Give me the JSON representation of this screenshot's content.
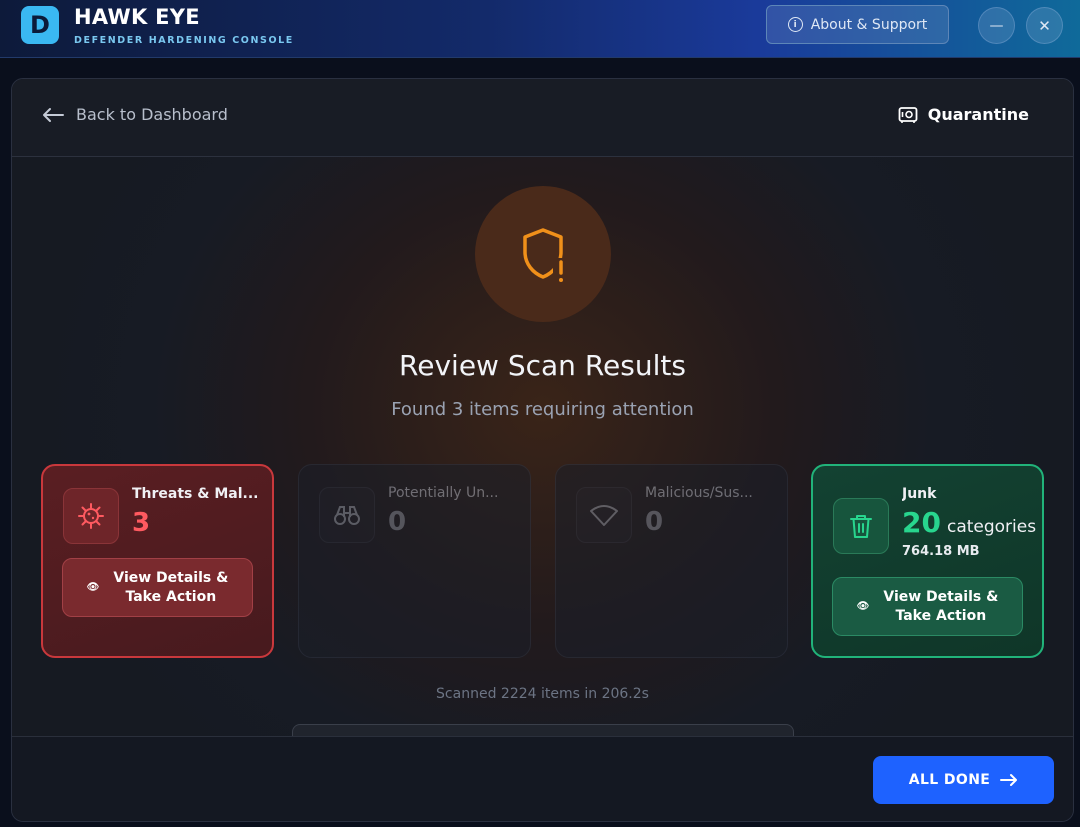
{
  "app": {
    "logo_letter": "D",
    "title": "HAWK EYE",
    "subtitle": "DEFENDER HARDENING CONSOLE",
    "about_label": "About & Support",
    "minimize_glyph": "—",
    "close_glyph": "✕"
  },
  "header": {
    "back_label": "Back to Dashboard",
    "quarantine_label": "Quarantine"
  },
  "main": {
    "title": "Review Scan Results",
    "subtitle": "Found 3 items requiring attention",
    "scan_summary": "Scanned 2224 items in 206.2s"
  },
  "cards": {
    "threats": {
      "name": "Threats & Mal...",
      "count": "3",
      "action_line1": "View Details &",
      "action_line2": "Take Action",
      "icon": "virus-icon"
    },
    "pup": {
      "name": "Potentially Un...",
      "count": "0",
      "icon": "binoculars-icon"
    },
    "malicious": {
      "name": "Malicious/Sus...",
      "count": "0",
      "icon": "wifi-icon"
    },
    "junk": {
      "name": "Junk",
      "count": "20",
      "unit": "categories",
      "size": "764.18 MB",
      "action_line1": "View Details &",
      "action_line2": "Take Action",
      "icon": "trash-icon"
    }
  },
  "footer": {
    "done_label": "ALL DONE"
  },
  "colors": {
    "accent_blue": "#1e62ff",
    "threat_red": "#ff5a60",
    "junk_green": "#28d58e",
    "shield_orange": "#f0901a"
  }
}
